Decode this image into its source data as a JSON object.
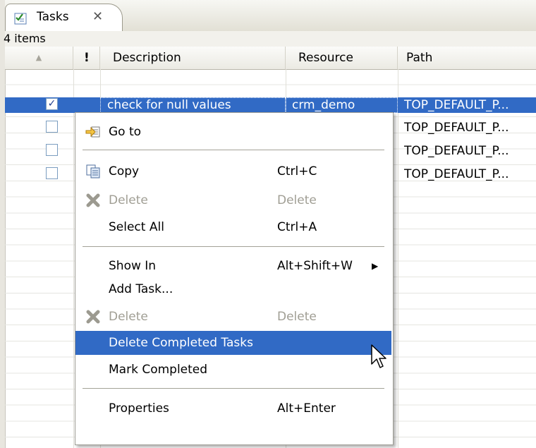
{
  "tab": {
    "title": "Tasks",
    "icon": "tasks-icon",
    "close_icon": "close-icon"
  },
  "item_count": "4 items",
  "columns": {
    "sort": "▲",
    "priority": "!",
    "description": "Description",
    "resource": "Resource",
    "path": "Path"
  },
  "rows": [
    {
      "checked": true,
      "description": "check for null values",
      "resource": "crm_demo",
      "path": "TOP_DEFAULT_P..."
    },
    {
      "checked": false,
      "description": "",
      "resource": "",
      "path": "TOP_DEFAULT_P..."
    },
    {
      "checked": false,
      "description": "",
      "resource": "",
      "path": "TOP_DEFAULT_P..."
    },
    {
      "checked": false,
      "description": "",
      "resource": "",
      "path": "TOP_DEFAULT_P..."
    }
  ],
  "checkmark": "✓",
  "menu": {
    "goto": {
      "label": "Go to",
      "icon": "goto-icon"
    },
    "copy": {
      "label": "Copy",
      "shortcut": "Ctrl+C",
      "icon": "copy-icon"
    },
    "delete1": {
      "label": "Delete",
      "shortcut": "Delete",
      "icon": "delete-x-icon",
      "enabled": false
    },
    "select_all": {
      "label": "Select All",
      "shortcut": "Ctrl+A"
    },
    "show_in": {
      "label": "Show In",
      "shortcut": "Alt+Shift+W",
      "submenu_arrow": "▶"
    },
    "add_task": {
      "label": "Add Task..."
    },
    "delete2": {
      "label": "Delete",
      "shortcut": "Delete",
      "icon": "delete-x-icon",
      "enabled": false
    },
    "delete_completed": {
      "label": "Delete Completed Tasks",
      "highlighted": true
    },
    "mark_completed": {
      "label": "Mark Completed"
    },
    "properties": {
      "label": "Properties",
      "shortcut": "Alt+Enter"
    }
  },
  "colors": {
    "selection": "#316ac5",
    "menu_border": "#9e9d95",
    "disabled_text": "#a09e94"
  }
}
